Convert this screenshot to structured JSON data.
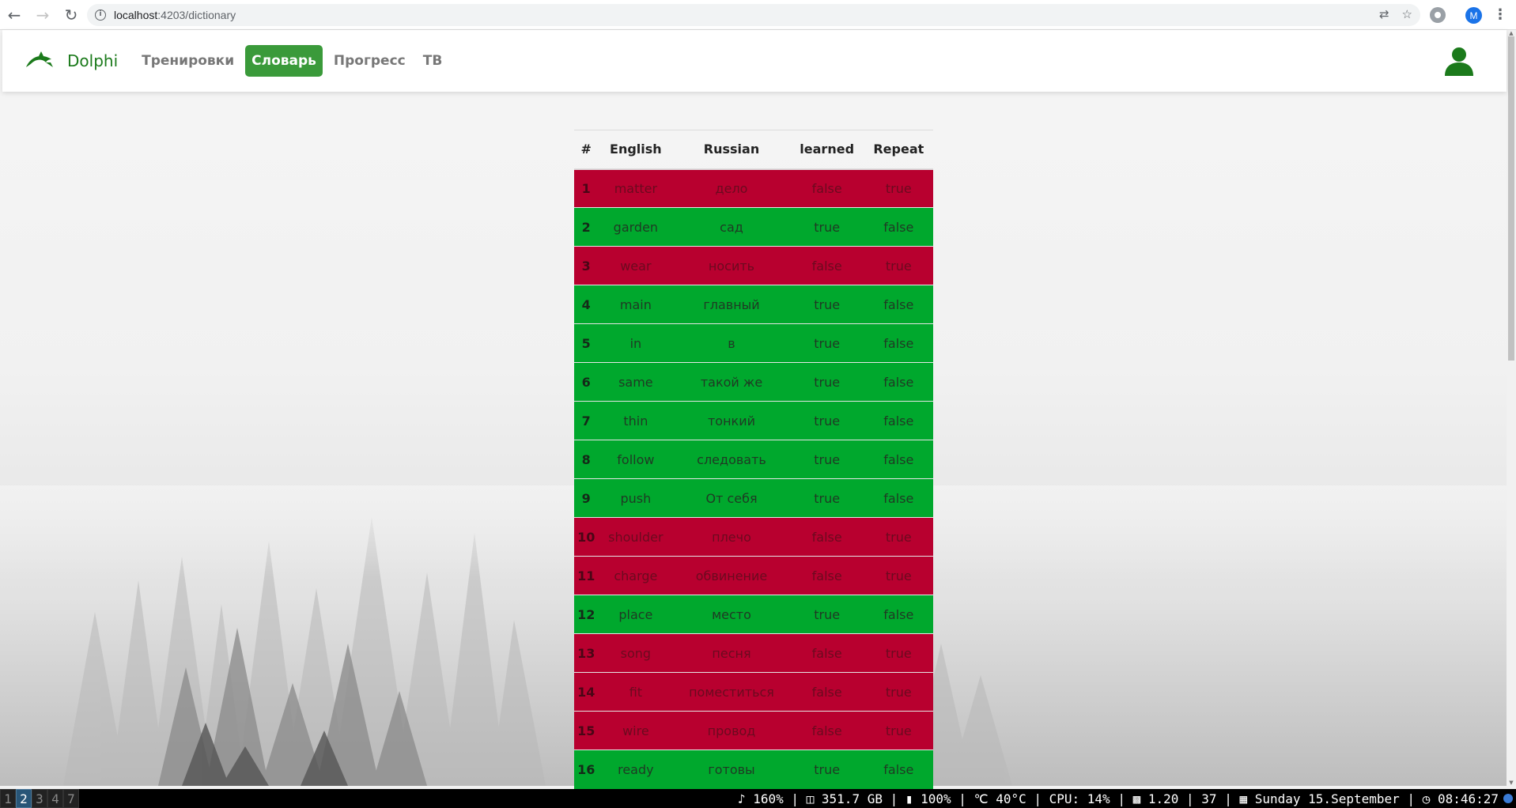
{
  "browser": {
    "url_host": "localhost",
    "url_rest": ":4203/dictionary",
    "profile_initial": "M"
  },
  "app": {
    "brand": "Dolphi",
    "nav": [
      {
        "label": "Тренировки",
        "active": false
      },
      {
        "label": "Словарь",
        "active": true
      },
      {
        "label": "Прогресс",
        "active": false
      },
      {
        "label": "ТВ",
        "active": false
      }
    ]
  },
  "table": {
    "headers": [
      "#",
      "English",
      "Russian",
      "learned",
      "Repeat"
    ],
    "rows": [
      {
        "num": "1",
        "english": "matter",
        "russian": "дело",
        "learned": "false",
        "repeat": "true"
      },
      {
        "num": "2",
        "english": "garden",
        "russian": "сад",
        "learned": "true",
        "repeat": "false"
      },
      {
        "num": "3",
        "english": "wear",
        "russian": "носить",
        "learned": "false",
        "repeat": "true"
      },
      {
        "num": "4",
        "english": "main",
        "russian": "главный",
        "learned": "true",
        "repeat": "false"
      },
      {
        "num": "5",
        "english": "in",
        "russian": "в",
        "learned": "true",
        "repeat": "false"
      },
      {
        "num": "6",
        "english": "same",
        "russian": "такой же",
        "learned": "true",
        "repeat": "false"
      },
      {
        "num": "7",
        "english": "thin",
        "russian": "тонкий",
        "learned": "true",
        "repeat": "false"
      },
      {
        "num": "8",
        "english": "follow",
        "russian": "следовать",
        "learned": "true",
        "repeat": "false"
      },
      {
        "num": "9",
        "english": "push",
        "russian": "От себя",
        "learned": "true",
        "repeat": "false"
      },
      {
        "num": "10",
        "english": "shoulder",
        "russian": "плечо",
        "learned": "false",
        "repeat": "true"
      },
      {
        "num": "11",
        "english": "charge",
        "russian": "обвинение",
        "learned": "false",
        "repeat": "true"
      },
      {
        "num": "12",
        "english": "place",
        "russian": "место",
        "learned": "true",
        "repeat": "false"
      },
      {
        "num": "13",
        "english": "song",
        "russian": "песня",
        "learned": "false",
        "repeat": "true"
      },
      {
        "num": "14",
        "english": "fit",
        "russian": "поместиться",
        "learned": "false",
        "repeat": "true"
      },
      {
        "num": "15",
        "english": "wire",
        "russian": "провод",
        "learned": "false",
        "repeat": "true"
      },
      {
        "num": "16",
        "english": "ready",
        "russian": "готовы",
        "learned": "true",
        "repeat": "false"
      }
    ]
  },
  "taskbar": {
    "workspaces": [
      {
        "label": "1",
        "active": false
      },
      {
        "label": "2",
        "active": true
      },
      {
        "label": "3",
        "active": false
      },
      {
        "label": "4",
        "active": false
      },
      {
        "label": "7",
        "active": false
      }
    ],
    "volume": "♪ 160%",
    "disk": "351.7 GB",
    "battery": "100%",
    "temp": "40°C",
    "cpu": "CPU: 14%",
    "load": "1.20",
    "load_extra": "37",
    "date": "Sunday 15.September",
    "time": "08:46:27"
  },
  "colors": {
    "brand_green": "#1b7a1b",
    "active_nav": "#3a9a3a",
    "row_learned": "#00a82d",
    "row_repeat": "#b8002f"
  }
}
